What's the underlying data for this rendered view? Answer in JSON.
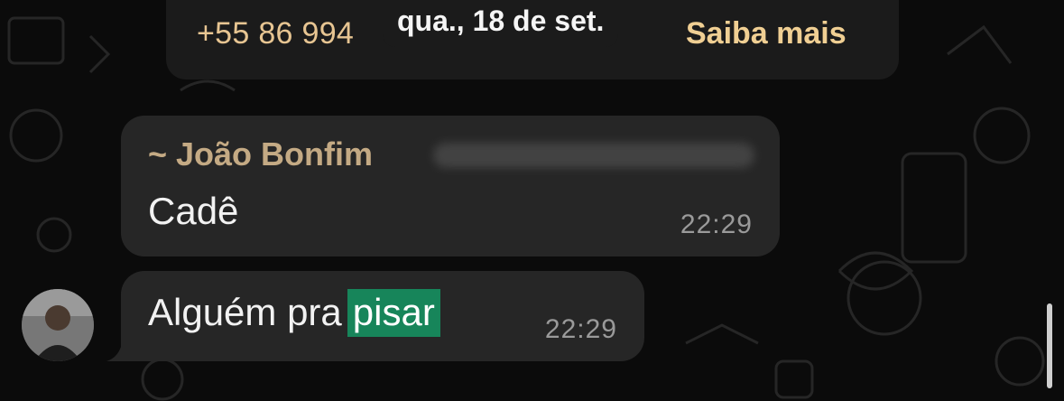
{
  "system_notice": {
    "text": "+55 86 994",
    "link_label": "Saiba mais"
  },
  "date_chip": "qua., 18 de set.",
  "messages": [
    {
      "sender": "~ João Bonfim",
      "text": "Cadê",
      "time": "22:29"
    },
    {
      "text_plain": "Alguém pra",
      "text_highlight": "pisar",
      "time": "22:29"
    }
  ],
  "colors": {
    "background": "#0b0b0b",
    "bubble": "#262626",
    "sender": "#c4aa84",
    "highlight": "#17855a",
    "notice_text": "#e7c592"
  },
  "icons": [
    "avatar",
    "scrollbar"
  ]
}
